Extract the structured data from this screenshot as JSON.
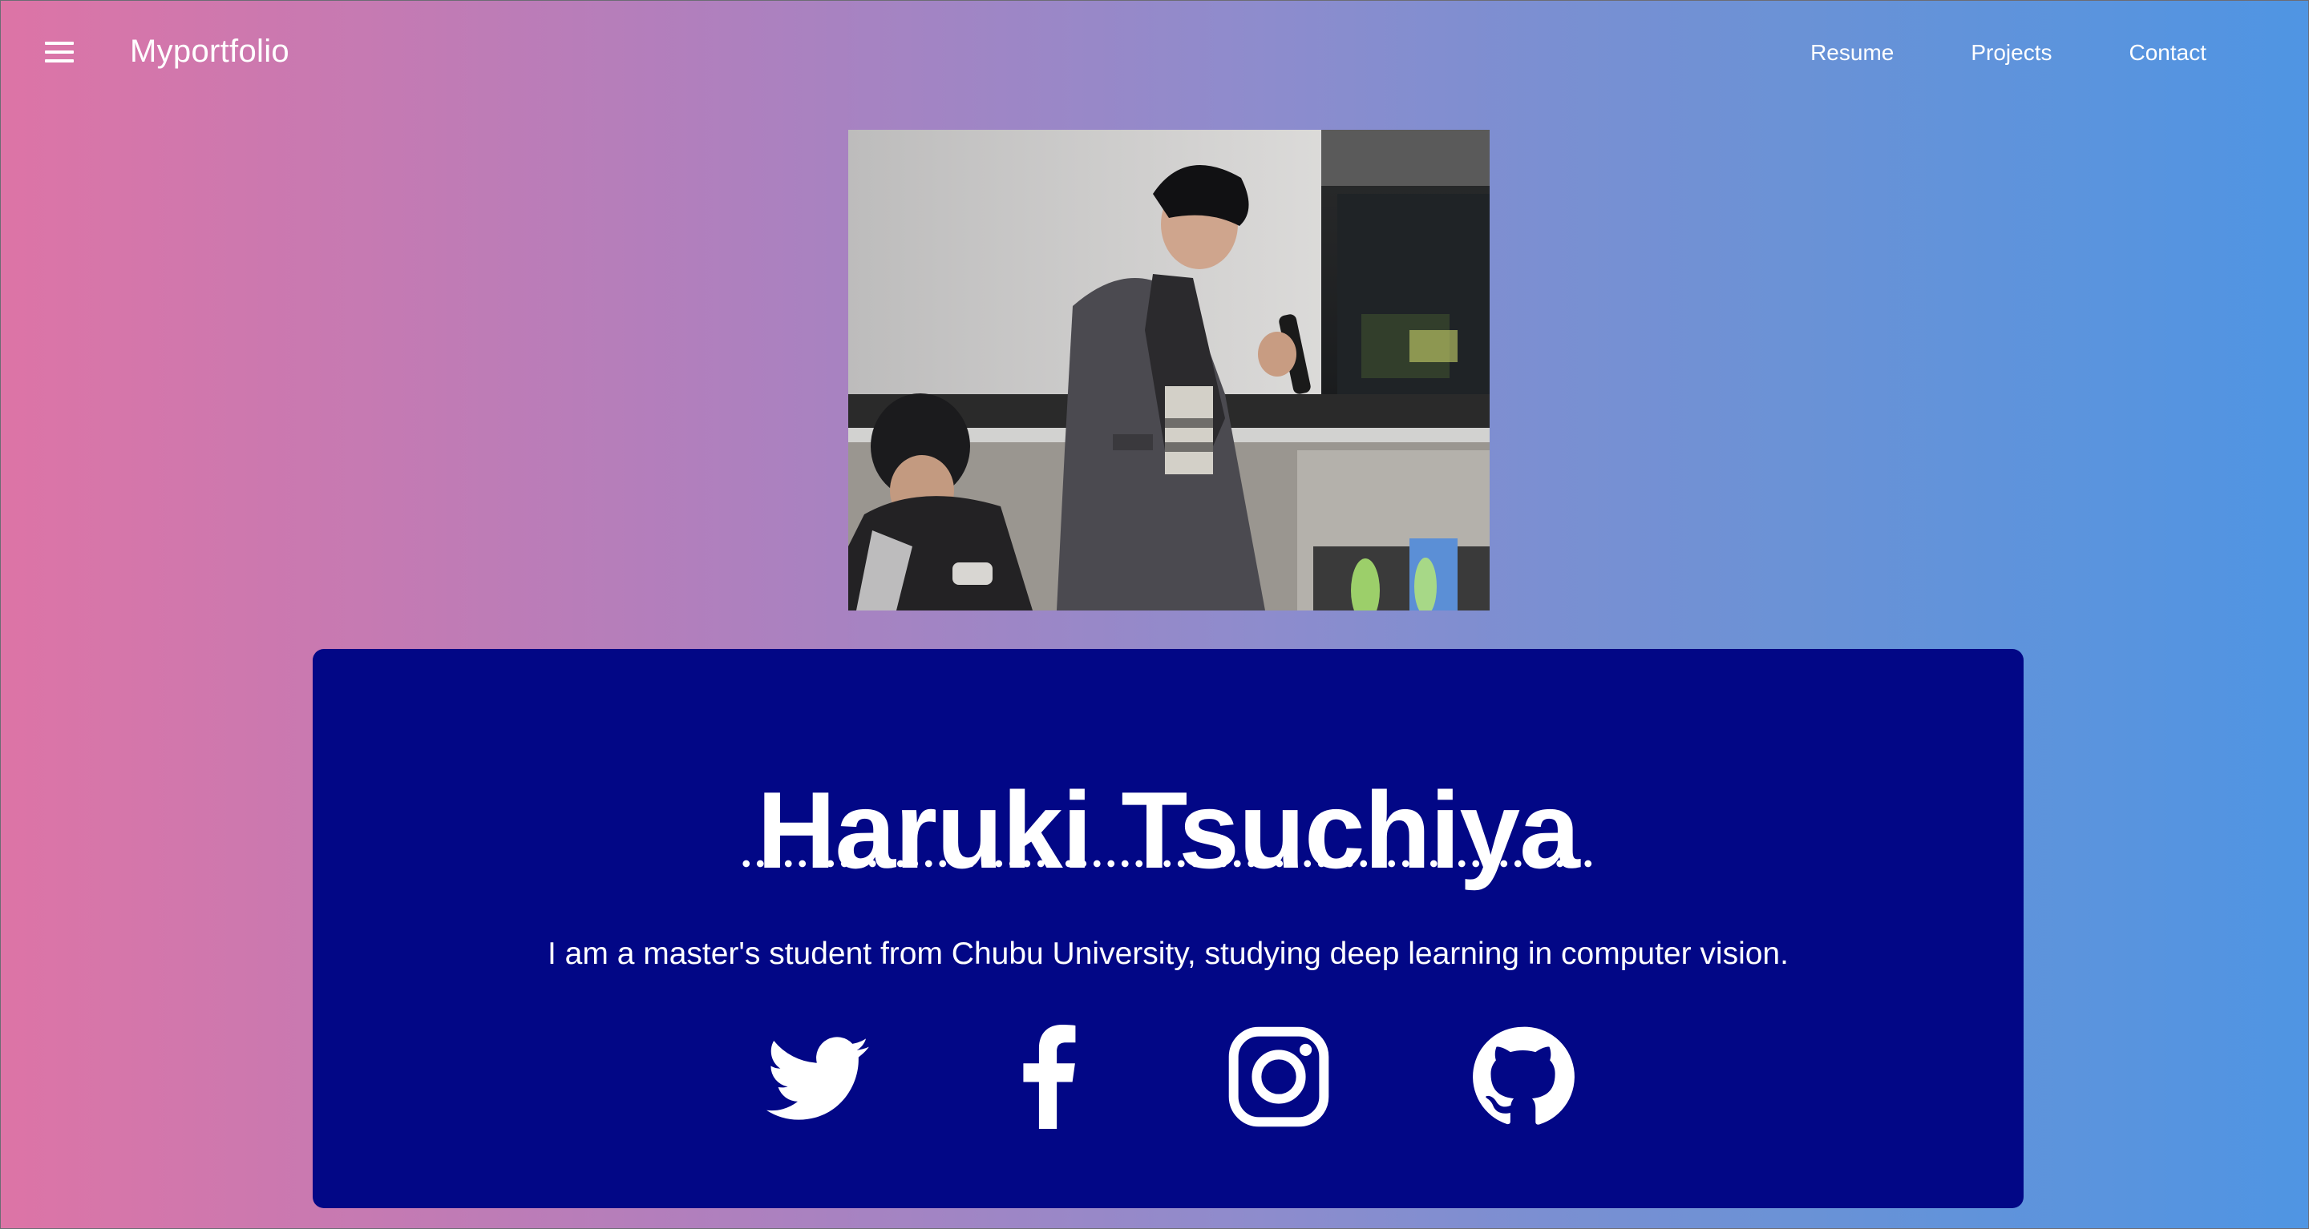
{
  "header": {
    "brand": "Myportfolio",
    "menu_icon": "hamburger-menu-icon",
    "nav": [
      {
        "label": "Resume"
      },
      {
        "label": "Projects"
      },
      {
        "label": "Contact"
      }
    ]
  },
  "hero": {
    "photo_icon": "profile-photo",
    "name": "Haruki Tsuchiya",
    "tagline": "I am a master's student from Chubu University, studying deep learning in computer vision.",
    "card_color": "#020786",
    "social": [
      {
        "icon": "twitter-icon"
      },
      {
        "icon": "facebook-icon"
      },
      {
        "icon": "instagram-icon"
      },
      {
        "icon": "github-icon"
      }
    ]
  },
  "colors": {
    "gradient_left": "#dd74a6",
    "gradient_right": "#4f95e3",
    "text": "#ffffff"
  }
}
